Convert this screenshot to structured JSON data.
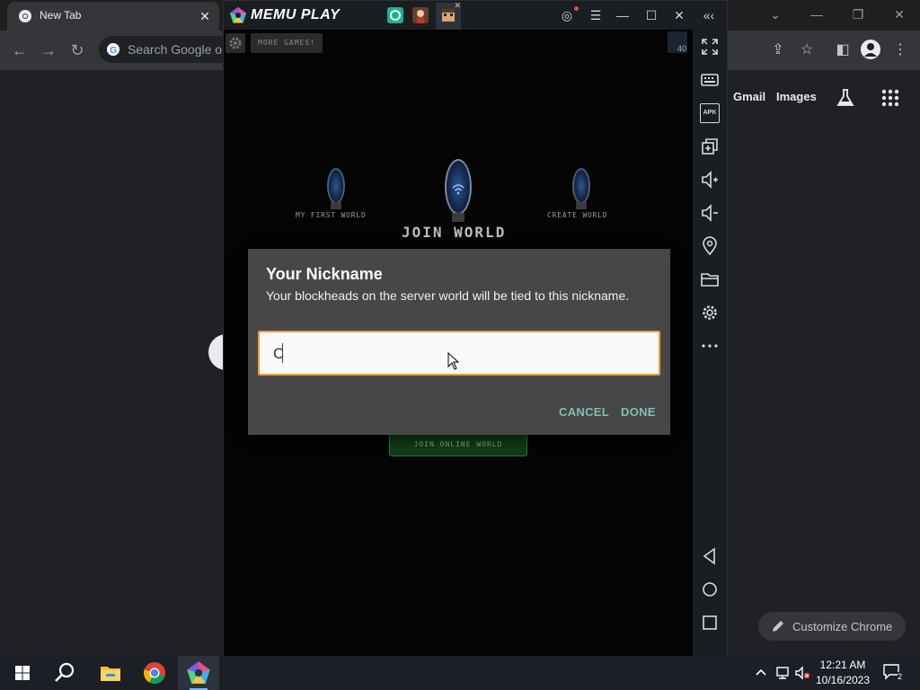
{
  "chrome": {
    "tab_title": "New Tab",
    "tab_close": "✕",
    "omnibox_placeholder": "Search Google or type a URL",
    "window_controls": {
      "minimize": "—",
      "restore": "❐",
      "close": "✕",
      "dropdown": "⌄"
    },
    "ntp": {
      "gmail": "Gmail",
      "images": "Images"
    },
    "customize_label": "Customize Chrome"
  },
  "memu": {
    "brand": "MEMU PLAY",
    "window_controls": {
      "account": "◎",
      "menu": "☰",
      "minimize": "—",
      "maximize": "☐",
      "close": "✕",
      "collapse": "«‹"
    },
    "sidebar": [
      "fullscreen-icon",
      "keyboard-icon",
      "apk-icon",
      "multi-window-icon",
      "volume-up-icon",
      "volume-down-icon",
      "location-icon",
      "folder-icon",
      "settings-icon",
      "more-icon",
      "back-icon",
      "home-icon",
      "recents-icon"
    ],
    "apk_label": "APK"
  },
  "game": {
    "more_games": "MORE GAMES!",
    "badge_number": "40",
    "worlds": [
      {
        "label": "MY FIRST WORLD"
      },
      {
        "label": "JOIN WORLD"
      },
      {
        "label": "CREATE WORLD"
      }
    ],
    "join_online": "JOIN ONLINE WORLD"
  },
  "dialog": {
    "title": "Your Nickname",
    "description": "Your blockheads on the server world will be tied to this nickname.",
    "input_value": "C",
    "cancel": "CANCEL",
    "done": "DONE",
    "accent_color": "#f09a3a",
    "button_color": "#7fbfb5"
  },
  "taskbar": {
    "time": "12:21 AM",
    "date": "10/16/2023",
    "notification_count": "2"
  }
}
